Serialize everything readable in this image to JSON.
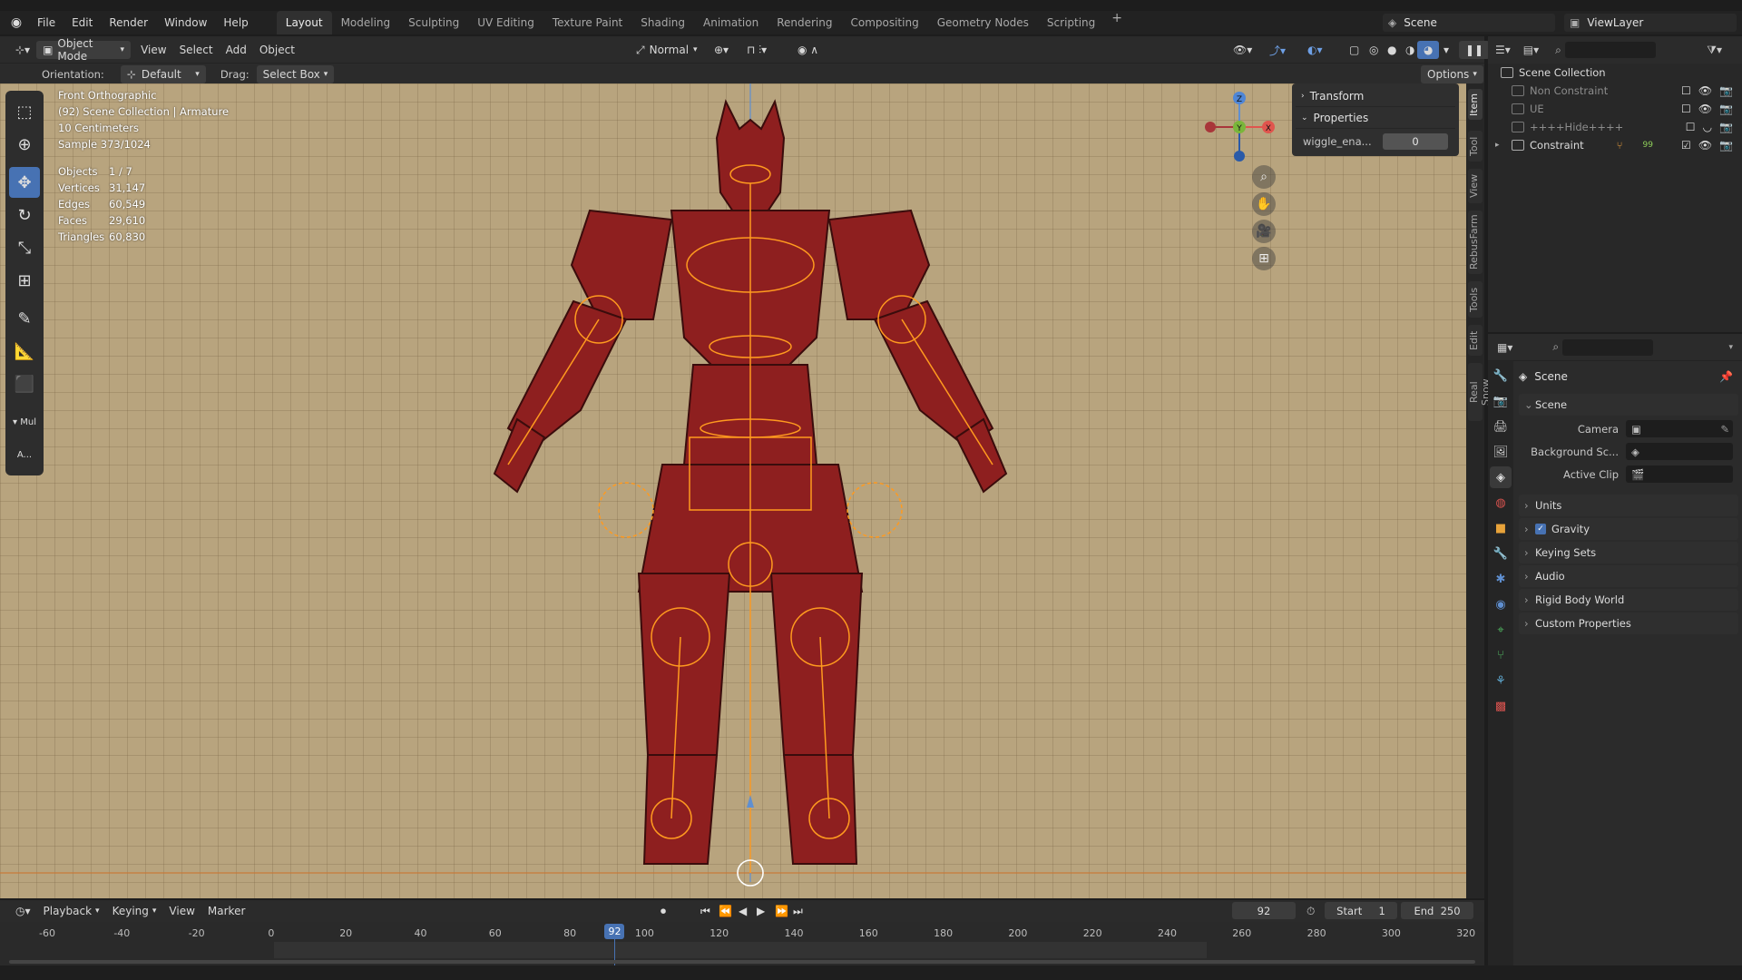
{
  "topbar": {
    "menus": [
      "File",
      "Edit",
      "Render",
      "Window",
      "Help"
    ],
    "workspaces": [
      "Layout",
      "Modeling",
      "Sculpting",
      "UV Editing",
      "Texture Paint",
      "Shading",
      "Animation",
      "Rendering",
      "Compositing",
      "Geometry Nodes",
      "Scripting"
    ],
    "active_workspace": "Layout",
    "scene": "Scene",
    "view_layer": "ViewLayer"
  },
  "viewport_header": {
    "mode": "Object Mode",
    "menus": [
      "View",
      "Select",
      "Add",
      "Object"
    ],
    "transform_orientation": "Normal"
  },
  "tool_header": {
    "orientation_label": "Orientation:",
    "orientation_value": "Default",
    "drag_label": "Drag:",
    "drag_value": "Select Box",
    "options": "Options"
  },
  "viewport_info": {
    "view": "Front Orthographic",
    "collection": "(92) Scene Collection | Armature",
    "scale": "10 Centimeters",
    "sample": "Sample 373/1024"
  },
  "stats": [
    {
      "k": "Objects",
      "v": "1 / 7"
    },
    {
      "k": "Vertices",
      "v": "31,147"
    },
    {
      "k": "Edges",
      "v": "60,549"
    },
    {
      "k": "Faces",
      "v": "29,610"
    },
    {
      "k": "Triangles",
      "v": "60,830"
    }
  ],
  "toolbar_extra": {
    "mul": "Mul",
    "a": "A..."
  },
  "npanel": {
    "transform": "Transform",
    "properties": "Properties",
    "prop_name": "wiggle_ena...",
    "prop_value": "0"
  },
  "side_tabs": [
    "Item",
    "Tool",
    "View",
    "RebusFarm",
    "Tools",
    "Edit",
    "Real Snow"
  ],
  "gizmo": {
    "z": "Z",
    "y": "Y",
    "x": "X"
  },
  "outliner": {
    "root": "Scene Collection",
    "items": [
      {
        "label": "Non Constraint"
      },
      {
        "label": "UE"
      },
      {
        "label": "++++Hide++++"
      },
      {
        "label": "Constraint"
      }
    ],
    "constraint_count": "99"
  },
  "properties": {
    "header": "Scene",
    "section": "Scene",
    "camera_label": "Camera",
    "background_label": "Background Sc...",
    "active_clip_label": "Active Clip",
    "sections": [
      "Units",
      "Gravity",
      "Keying Sets",
      "Audio",
      "Rigid Body World",
      "Custom Properties"
    ]
  },
  "timeline": {
    "menus": [
      "Playback",
      "Keying",
      "View",
      "Marker"
    ],
    "current_frame": "92",
    "start_label": "Start",
    "start": "1",
    "end_label": "End",
    "end": "250",
    "ticks": [
      "-60",
      "-40",
      "-20",
      "0",
      "20",
      "40",
      "60",
      "80",
      "100",
      "120",
      "140",
      "160",
      "180",
      "200",
      "220",
      "240",
      "260",
      "280",
      "300",
      "320"
    ]
  }
}
